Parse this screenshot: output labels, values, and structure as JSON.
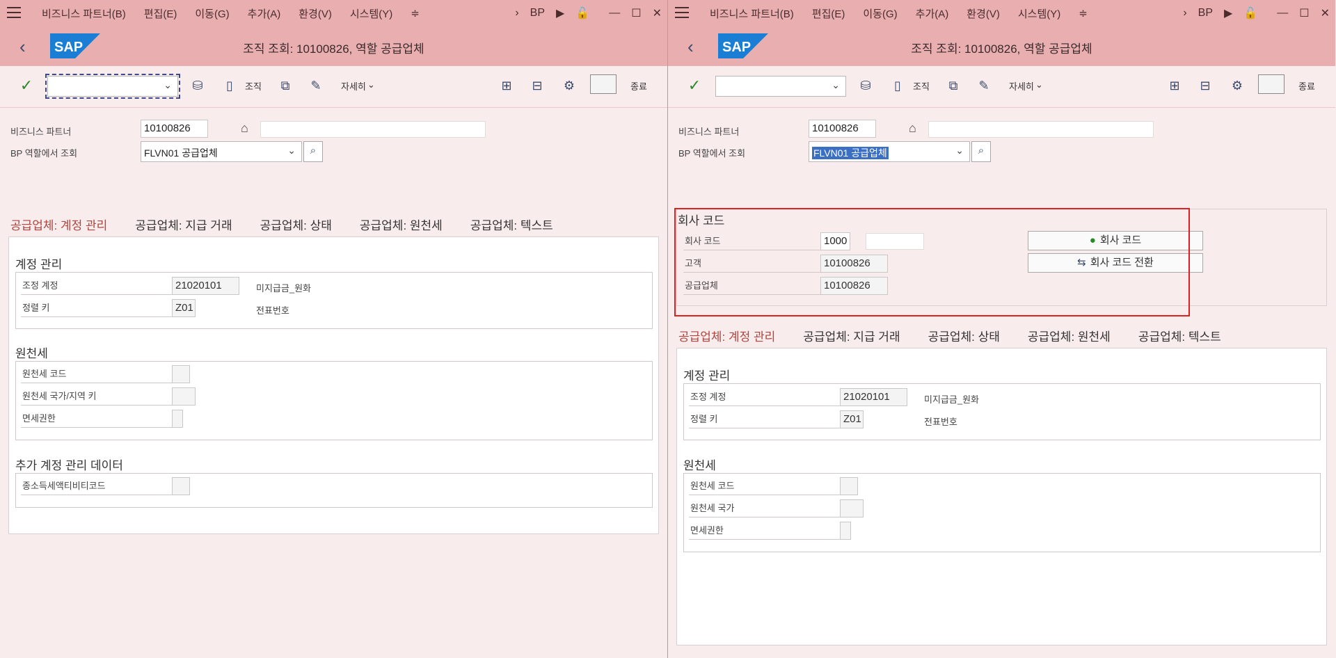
{
  "menu": {
    "items": [
      "비즈니스 파트너(B)",
      "편집(E)",
      "이동(G)",
      "추가(A)",
      "환경(V)",
      "시스템(Y)"
    ],
    "bp_label": "BP"
  },
  "title": "조직 조회: 10100826, 역할 공급업체",
  "toolbar": {
    "org_label": "조직",
    "detail_label": "자세히",
    "exit_label": "종료"
  },
  "header": {
    "bp_label": "비즈니스 파트너",
    "bp_value": "10100826",
    "role_label": "BP 역할에서 조회",
    "role_value": "FLVN01 공급업체"
  },
  "tabs": [
    "공급업체: 계정 관리",
    "공급업체: 지급 거래",
    "공급업체: 상태",
    "공급업체: 원천세",
    "공급업체: 텍스트"
  ],
  "left": {
    "account_title": "계정 관리",
    "recon_label": "조정 계정",
    "recon_value": "21020101",
    "recon_desc": "미지급금_원화",
    "sort_label": "정렬 키",
    "sort_value": "Z01",
    "sort_desc": "전표번호",
    "wht_title": "원천세",
    "wht_code_label": "원천세 코드",
    "wht_country_label": "원천세 국가/지역 키",
    "exempt_label": "면세권한",
    "extra_title": "추가 계정 관리 데이터",
    "activity_label": "종소득세액티비티코드"
  },
  "right": {
    "company_title": "회사 코드",
    "cc_label": "회사 코드",
    "cc_value": "1000",
    "customer_label": "고객",
    "customer_value": "10100826",
    "vendor_label": "공급업체",
    "vendor_value": "10100826",
    "cc_button": "회사 코드",
    "cc_switch_button": "회사 코드 전환",
    "account_title": "계정 관리",
    "recon_label": "조정 계정",
    "recon_value": "21020101",
    "recon_desc": "미지급금_원화",
    "sort_label": "정렬 키",
    "sort_value": "Z01",
    "sort_desc": "전표번호",
    "wht_title": "원천세",
    "wht_code_label": "원천세 코드",
    "wht_country_label": "원천세 국가",
    "exempt_label": "면세권한"
  }
}
